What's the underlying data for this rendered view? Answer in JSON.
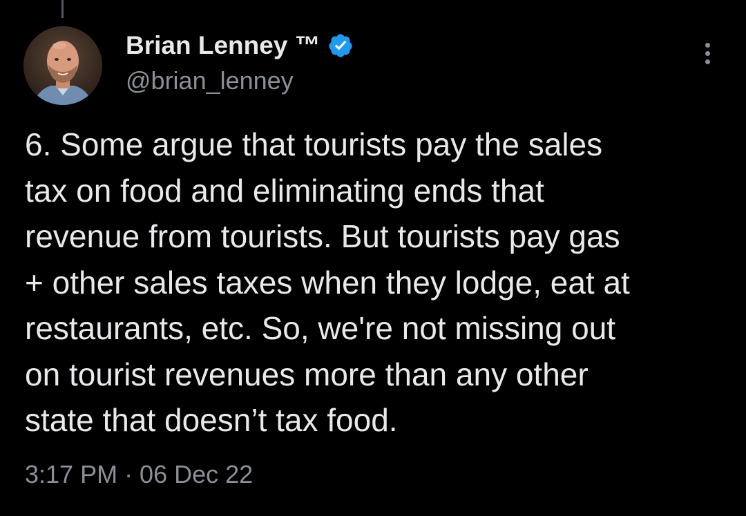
{
  "tweet": {
    "author": {
      "display_name": "Brian Lenney ™",
      "handle": "@brian_lenney",
      "verified": true,
      "verified_color": "#1d9bf0"
    },
    "text": "6. Some argue that tourists pay the sales\ntax on food and eliminating ends that\nrevenue from tourists. But tourists pay gas\n+ other sales taxes when they lodge, eat at\nrestaurants, etc. So, we're not missing out\non tourist revenues more than any other\nstate that doesn’t tax food.",
    "timestamp": "3:17 PM · 06 Dec 22",
    "more_icon": "more-vertical-icon"
  },
  "theme": {
    "background": "#000000",
    "text": "#e7e9ea",
    "secondary_text": "#8b9096"
  }
}
